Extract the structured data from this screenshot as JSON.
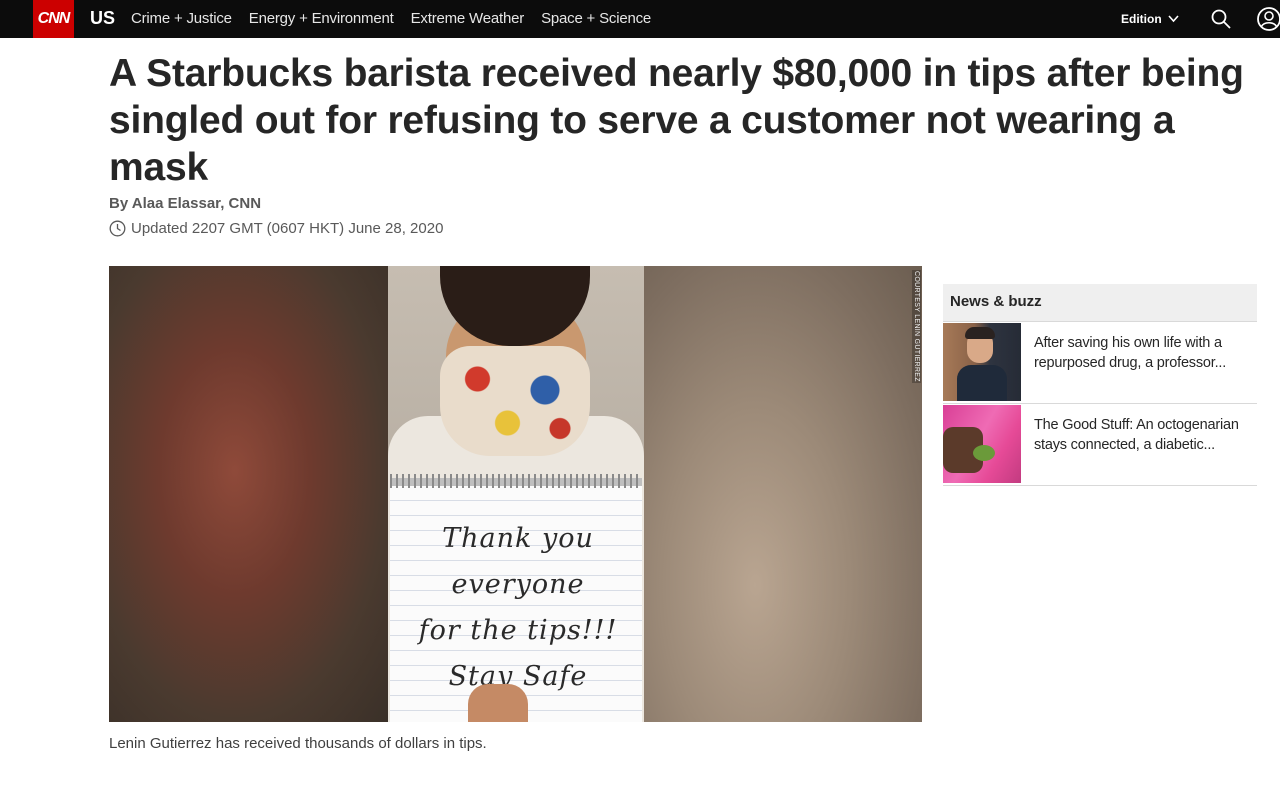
{
  "nav": {
    "logo": "CNN",
    "section": "US",
    "links": [
      "Crime + Justice",
      "Energy + Environment",
      "Extreme Weather",
      "Space + Science"
    ],
    "edition_label": "Edition"
  },
  "article": {
    "headline": "A Starbucks barista received nearly $80,000 in tips after being singled out for refusing to serve a customer not wearing a mask",
    "byline": "By Alaa Elassar, CNN",
    "updated": "Updated 2207 GMT (0607 HKT) June 28, 2020",
    "photo_note": "Thank you everyone\nfor the tips!!!\nStay Safe",
    "photo_credit": "COURTESY LENIN GUTIERREZ",
    "caption": "Lenin Gutierrez has received thousands of dollars in tips."
  },
  "sidebar": {
    "title": "News & buzz",
    "items": [
      {
        "text": "After saving his own life with a repurposed drug, a professor..."
      },
      {
        "text": "The Good Stuff: An octogenarian stays connected, a diabetic..."
      }
    ]
  },
  "colors": {
    "nav_bg": "#0c0c0c",
    "brand_red": "#cc0000"
  }
}
